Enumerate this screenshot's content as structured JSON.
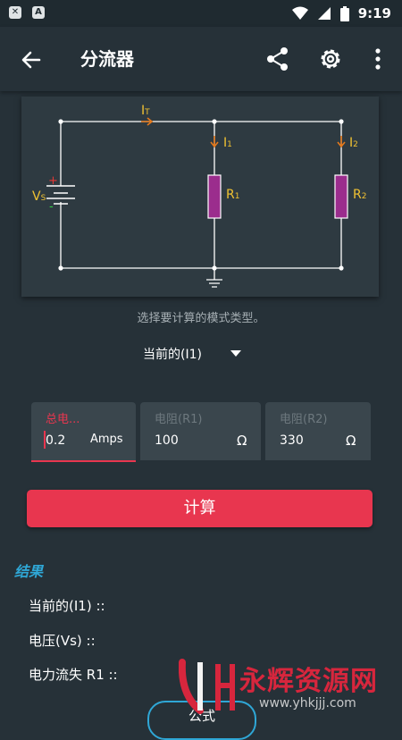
{
  "status_bar": {
    "time": "9:19"
  },
  "app_bar": {
    "title": "分流器"
  },
  "circuit": {
    "labels": {
      "it": "I",
      "it_sub": "T",
      "i1": "I",
      "i1_sub": "1",
      "i2": "I",
      "i2_sub": "2",
      "vs": "V",
      "vs_sub": "S",
      "r1": "R",
      "r1_sub": "1",
      "r2": "R",
      "r2_sub": "2",
      "plus": "+",
      "minus": "-"
    },
    "colors": {
      "wire": "#ffffff",
      "resistor": "#9b2d8d",
      "label": "#f1c232",
      "arrow": "#e57a1c",
      "plus": "#e53935",
      "minus": "#2ecc40"
    }
  },
  "hint": "选择要计算的模式类型。",
  "mode_select": {
    "value": "当前的(I1)"
  },
  "inputs": [
    {
      "label": "总电...",
      "value": "0.2",
      "unit": "Amps"
    },
    {
      "label": "电阻(R1)",
      "value": "100",
      "unit": "Ω"
    },
    {
      "label": "电阻(R2)",
      "value": "330",
      "unit": "Ω"
    }
  ],
  "calculate_label": "计算",
  "results": {
    "heading": "结果",
    "items": [
      "当前的(I1) ::",
      "电压(Vs) ::",
      "电力流失 R1 ::"
    ]
  },
  "formula_label": "公式",
  "watermark": {
    "name": "永辉资源网",
    "url": "www.yhkjjj.com"
  },
  "accent": "#e8364f",
  "link_color": "#2fa7d6"
}
